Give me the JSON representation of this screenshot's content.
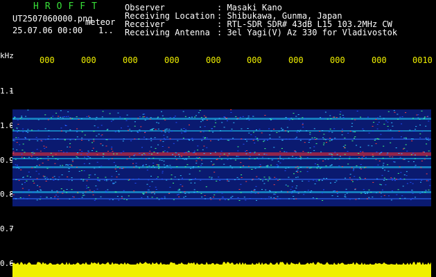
{
  "header": {
    "brand": "HROFFT",
    "filename": "UT2507060000.png",
    "label_meteor": "meteor",
    "datetime": "25.07.06 00:00",
    "count": "1..",
    "fields": [
      {
        "label": "Observer",
        "value": ": Masaki Kano"
      },
      {
        "label": "Receiving Location",
        "value": ": Shibukawa, Gunma, Japan"
      },
      {
        "label": "Receiver",
        "value": ": RTL-SDR SDR# 43dB L15 103.2MHz CW"
      },
      {
        "label": "Receiving Antenna",
        "value": ": 3el Yagi(V) Az 330 for Vladivostok"
      }
    ]
  },
  "axis": {
    "unit": "kHz",
    "y_ticks": [
      "1.1",
      "1.0",
      "0.9",
      "0.8",
      "0.7",
      "0.6"
    ],
    "time_labels": [
      "000",
      "000",
      "000",
      "000",
      "000",
      "000",
      "000",
      "000",
      "000",
      "0010"
    ]
  },
  "colors": {
    "background": "#000000",
    "header_text": "#ffffff",
    "accent_yellow": "#f0f000",
    "brand_green": "#38e038",
    "spectrogram_base": "#0a1a70",
    "signal_cyan": "#20d0ff",
    "signal_red": "#ff3030"
  }
}
